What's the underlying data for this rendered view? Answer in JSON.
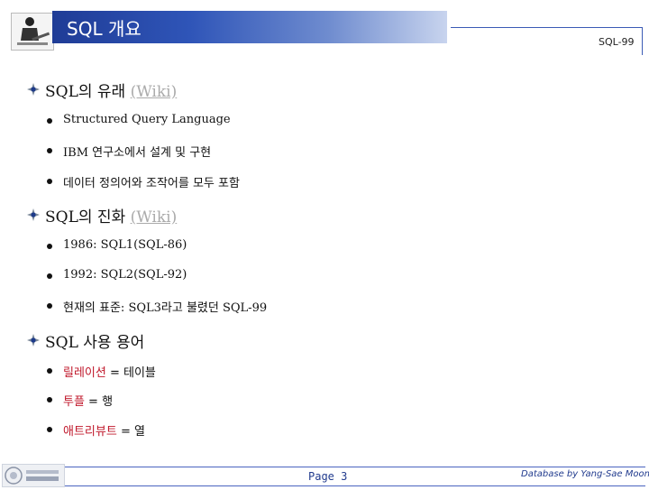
{
  "header": {
    "title": "SQL 개요",
    "right_label": "SQL-99"
  },
  "sections": [
    {
      "heading": "SQL의 유래",
      "link": "(Wiki)",
      "items": [
        "Structured Query Language",
        "IBM 연구소에서 설계 및 구현",
        "데이터 정의어와 조작어를 모두 포함"
      ]
    },
    {
      "heading": "SQL의 진화",
      "link": "(Wiki)",
      "items": [
        "1986: SQL1(SQL-86)",
        "1992: SQL2(SQL-92)",
        "현재의 표준: SQL3라고 불렸던 SQL-99"
      ]
    },
    {
      "heading": "SQL 사용 용어",
      "terms": [
        {
          "term": "릴레이션",
          "def": " = 테이블"
        },
        {
          "term": "투플",
          "def": " = 행"
        },
        {
          "term": "애트리뷰트",
          "def": " = 열"
        }
      ]
    }
  ],
  "footer": {
    "page": "Page 3",
    "credit": "Database by Yang-Sae Moon"
  },
  "colors": {
    "header_bar": "#2f55b8",
    "term_red": "#c0182b",
    "footer_blue": "#213b8e"
  }
}
